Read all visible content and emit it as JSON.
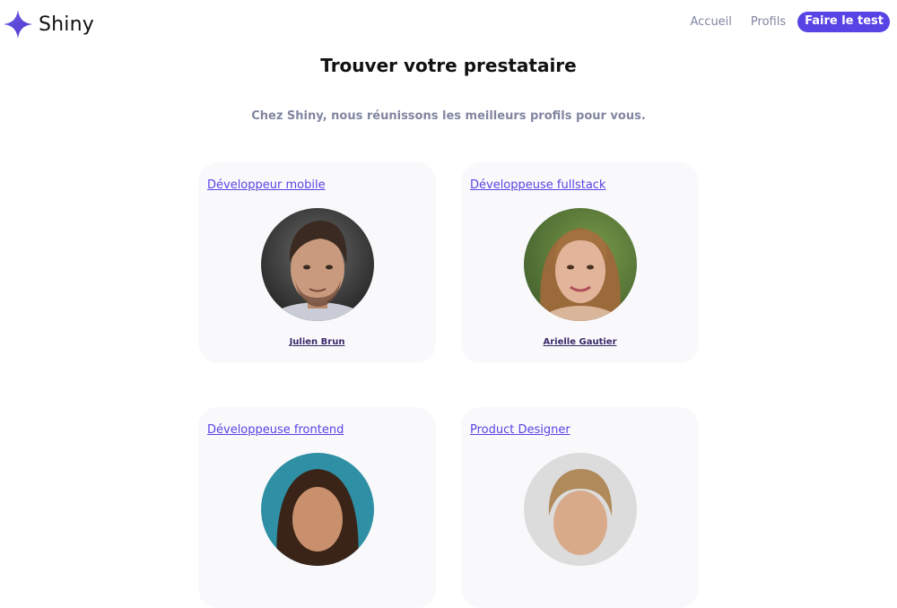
{
  "brand": {
    "name": "Shiny",
    "icon": "sparkle-star-icon",
    "accent": "#5843e4"
  },
  "nav": {
    "home": "Accueil",
    "profiles": "Profils",
    "cta": "Faire le test"
  },
  "page": {
    "title": "Trouver votre prestataire",
    "subtitle": "Chez Shiny, nous réunissons les meilleurs profils pour vous."
  },
  "cards": [
    {
      "job": "Développeur mobile",
      "name": "Julien Brun"
    },
    {
      "job": "Développeuse fullstack",
      "name": "Arielle Gautier"
    },
    {
      "job": "Développeuse frontend",
      "name": ""
    },
    {
      "job": "Product Designer",
      "name": ""
    }
  ]
}
